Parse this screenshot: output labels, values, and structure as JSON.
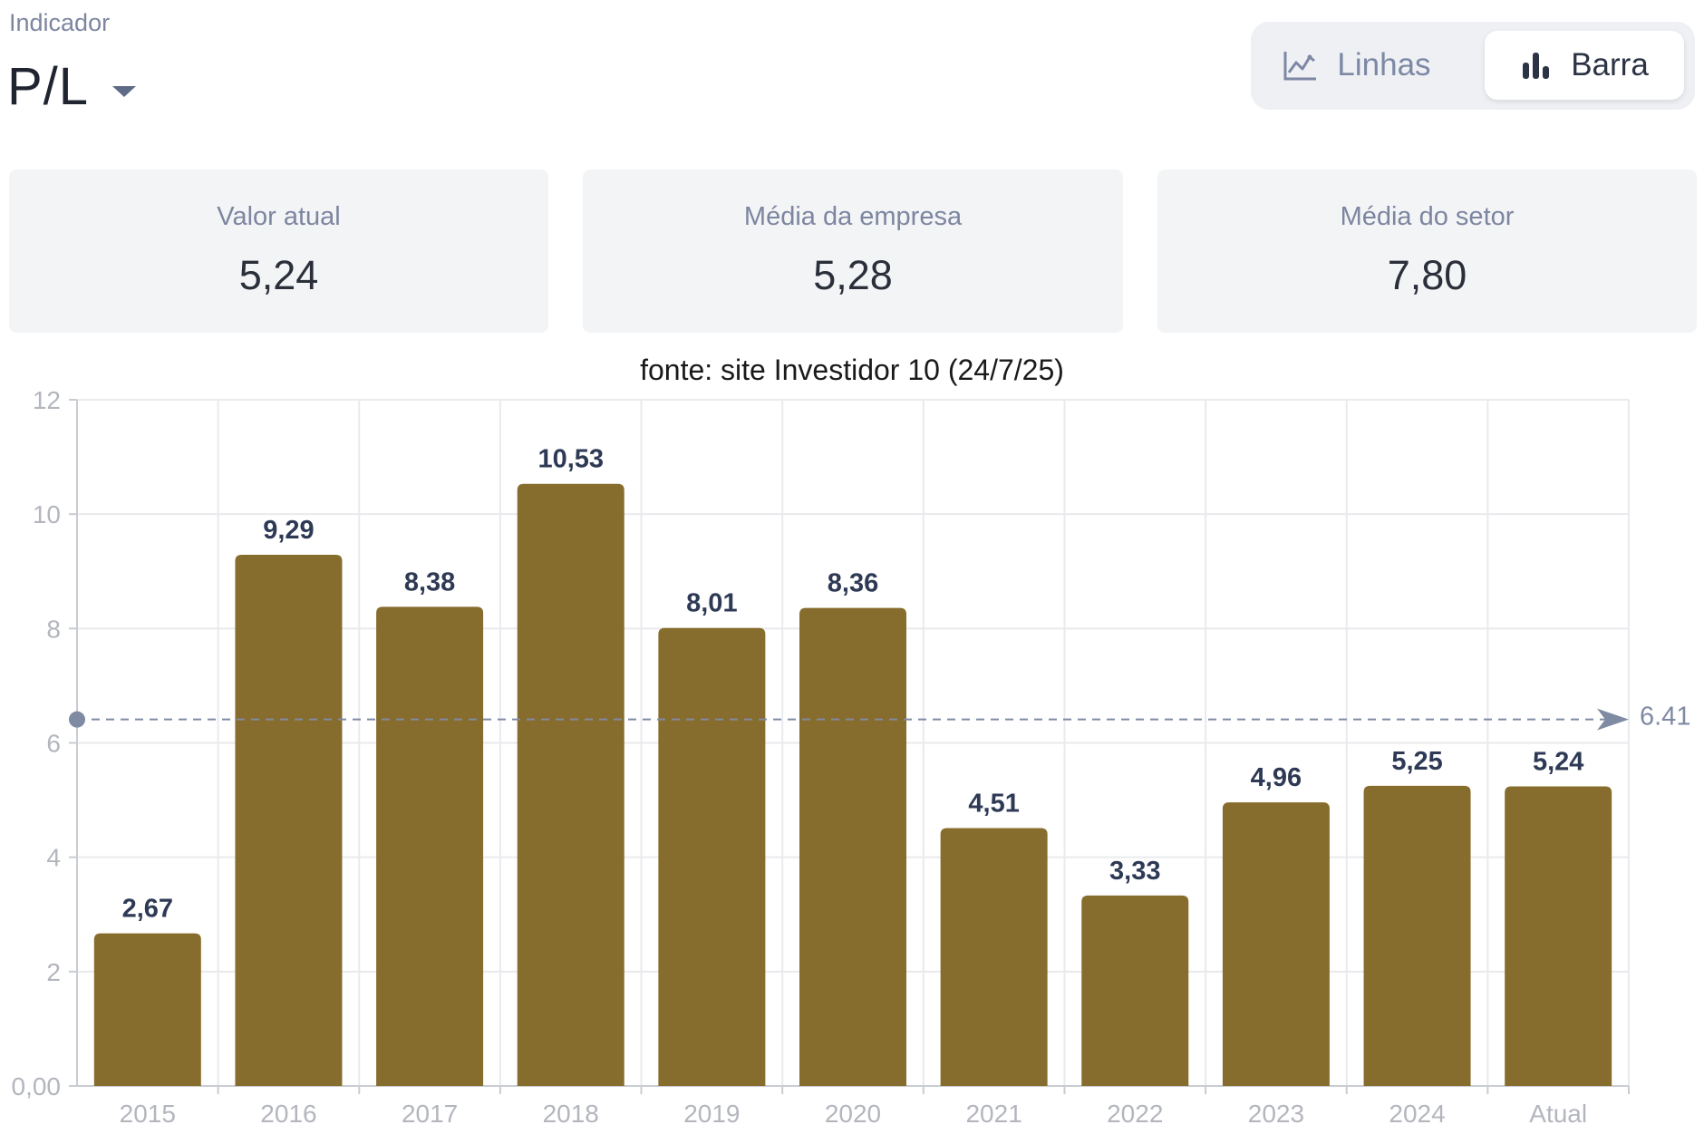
{
  "header": {
    "indicator_label": "Indicador",
    "indicator_value": "P/L",
    "view_toggle": {
      "lines_label": "Linhas",
      "bar_label": "Barra",
      "selected": "Barra"
    }
  },
  "cards": [
    {
      "label": "Valor atual",
      "value": "5,24"
    },
    {
      "label": "Média da empresa",
      "value": "5,28"
    },
    {
      "label": "Média do setor",
      "value": "7,80"
    }
  ],
  "source_note": "fonte: site Investidor 10 (24/7/25)",
  "colors": {
    "bar": "#876d2d",
    "grid": "#e9eaed",
    "axis_text": "#b3b6bd",
    "data_label": "#2e3a55",
    "average_line": "#7f8aa3"
  },
  "chart_data": {
    "type": "bar",
    "title": "",
    "xlabel": "",
    "ylabel": "",
    "categories": [
      "2015",
      "2016",
      "2017",
      "2018",
      "2019",
      "2020",
      "2021",
      "2022",
      "2023",
      "2024",
      "Atual"
    ],
    "values": [
      2.67,
      9.29,
      8.38,
      10.53,
      8.01,
      8.36,
      4.51,
      3.33,
      4.96,
      5.25,
      5.24
    ],
    "value_labels": [
      "2,67",
      "9,29",
      "8,38",
      "10,53",
      "8,01",
      "8,36",
      "4,51",
      "3,33",
      "4,96",
      "5,25",
      "5,24"
    ],
    "ylim": [
      0,
      12
    ],
    "yticks": [
      0,
      2,
      4,
      6,
      8,
      10,
      12
    ],
    "ytick_labels": [
      "0,00",
      "2",
      "4",
      "6",
      "8",
      "10",
      "12"
    ],
    "grid": true,
    "average_line": {
      "value": 6.41,
      "label": "6.41"
    }
  }
}
